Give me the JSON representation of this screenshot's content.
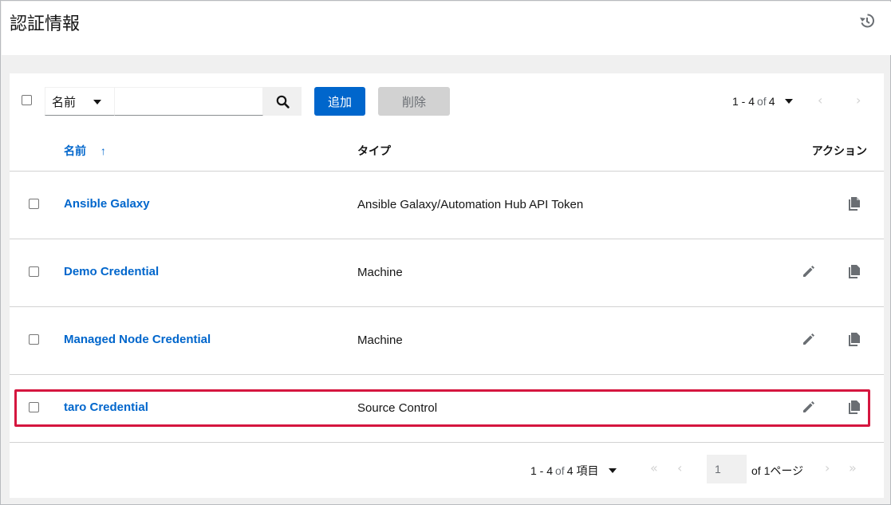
{
  "header": {
    "title": "認証情報",
    "history_icon": "history-icon"
  },
  "toolbar": {
    "search_field": "名前",
    "search_placeholder": "",
    "add_label": "追加",
    "delete_label": "削除",
    "pager": {
      "range": "1 - 4",
      "of": "of",
      "total": "4"
    }
  },
  "table": {
    "columns": {
      "name": "名前",
      "type": "タイプ",
      "actions": "アクション"
    },
    "sort_indicator": "↑",
    "rows": [
      {
        "name": "Ansible Galaxy",
        "type": "Ansible Galaxy/Automation Hub API Token",
        "editable": false
      },
      {
        "name": "Demo Credential",
        "type": "Machine",
        "editable": true
      },
      {
        "name": "Managed Node Credential",
        "type": "Machine",
        "editable": true
      },
      {
        "name": "taro Credential",
        "type": "Source Control",
        "editable": true,
        "highlighted": true
      }
    ]
  },
  "footer_pager": {
    "range": "1 - 4",
    "of": "of",
    "total": "4",
    "items_unit": "項目",
    "page_value": "1",
    "page_of": "of",
    "page_total": "1",
    "page_unit": "ページ"
  },
  "colors": {
    "link": "#0066cc",
    "highlight": "#d5163f",
    "primary_button": "#0066cc"
  }
}
